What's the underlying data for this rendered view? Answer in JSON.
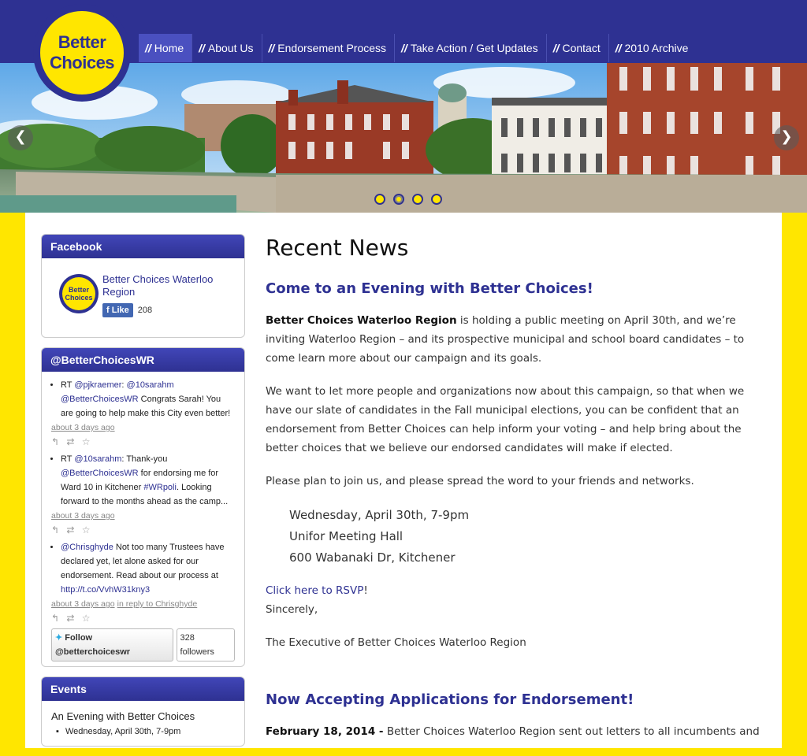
{
  "logo": {
    "line1": "Better",
    "line2": "Choices"
  },
  "nav": [
    {
      "label": "Home",
      "active": true
    },
    {
      "label": "About Us",
      "active": false
    },
    {
      "label": "Endorsement Process",
      "active": false
    },
    {
      "label": "Take Action / Get Updates",
      "active": false
    },
    {
      "label": "Contact",
      "active": false
    },
    {
      "label": "2010 Archive",
      "active": false
    }
  ],
  "nav_separator": "//",
  "slider": {
    "prev": "❮",
    "next": "❯",
    "dots": 4,
    "active_dot": 2
  },
  "sidebar": {
    "facebook": {
      "title": "Facebook",
      "page_name": "Better Choices Waterloo Region",
      "logo_line1": "Better",
      "logo_line2": "Choices",
      "like_label": "Like",
      "like_count": "208"
    },
    "twitter": {
      "title": "@BetterChoicesWR",
      "tweets": [
        {
          "prefix": "RT ",
          "mention1": "@pjkraemer",
          "sep": ": ",
          "mention2": "@10sarahm",
          "mention3": "@BetterChoicesWR",
          "text": " Congrats Sarah! You are going to help make this City even better!",
          "time": "about 3 days ago"
        },
        {
          "prefix": "RT ",
          "mention1": "@10sarahm",
          "sep": ": Thank-you ",
          "mention2": "@BetterChoicesWR",
          "text_a": " for endorsing me for Ward 10 in Kitchener ",
          "hashtag": "#WRpoli",
          "text_b": ". Looking forward to the months ahead as the camp...",
          "time": "about 3 days ago"
        },
        {
          "mention1": "@Chrisghyde",
          "text": " Not too many Trustees have declared yet, let alone asked for our endorsement. Read about our process at ",
          "link": "http://t.co/VvhW31kny3",
          "time": "about 3 days ago",
          "reply": "in reply to Chrisghyde"
        }
      ],
      "actions": "↰ ⇄ ☆",
      "follow_label": "Follow @betterchoiceswr",
      "followers": "328 followers"
    },
    "events": {
      "title": "Events",
      "event_title": "An Evening with Better Choices",
      "event_date": "Wednesday, April 30th, 7-9pm"
    }
  },
  "main": {
    "page_title": "Recent News",
    "post1": {
      "title": "Come to an Evening with Better Choices!",
      "p1_bold": "Better Choices Waterloo Region",
      "p1_rest": " is holding a public meeting on April 30th, and we’re inviting Waterloo Region – and its prospective municipal and school board candidates – to come learn more about our campaign and its goals.",
      "p2": "We want to let more people and organizations now about this campaign, so that when we have our slate of candidates in the Fall municipal elections, you can be confident that an endorsement from Better Choices can help inform your voting – and help bring about the better choices that we believe our endorsed candidates will make if elected.",
      "p3": "Please plan to join us, and please spread the word to your friends and networks.",
      "addr1": "Wednesday, April 30th, 7-9pm",
      "addr2": "Unifor Meeting Hall",
      "addr3": "600 Wabanaki Dr, Kitchener",
      "rsvp": "Click here to RSVP",
      "rsvp_end": "!",
      "sincerely": "Sincerely,",
      "signoff": "The Executive of Better Choices Waterloo Region"
    },
    "post2": {
      "title": "Now Accepting Applications for Endorsement!",
      "date": "February 18, 2014 -",
      "text": " Better Choices Waterloo Region sent out letters to all incumbents and"
    }
  }
}
